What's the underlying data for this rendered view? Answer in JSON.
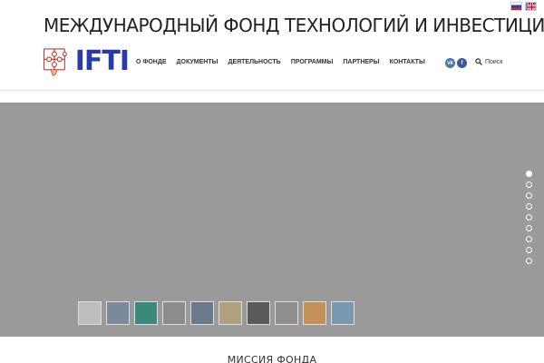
{
  "site": {
    "title": "МЕЖДУНАРОДНЫЙ ФОНД ТЕХНОЛОГИЙ И ИНВЕСТИЦИЙ",
    "logo_text": "IFTI"
  },
  "languages": [
    "ru-flag-icon",
    "gb-flag-icon"
  ],
  "nav": {
    "items": [
      {
        "label": "О ФОНДЕ"
      },
      {
        "label": "ДОКУМЕНТЫ"
      },
      {
        "label": "ДЕЯТЕЛЬНОСТЬ"
      },
      {
        "label": "ПРОГРАММЫ"
      },
      {
        "label": "ПАРТНЕРЫ"
      },
      {
        "label": "КОНТАКТЫ"
      }
    ]
  },
  "social": {
    "vk": "vk",
    "fb": "f"
  },
  "search": {
    "label": "Поиск"
  },
  "slider": {
    "thumb_colors": [
      "#bdbdbd",
      "#7a8a9a",
      "#3a8a7a",
      "#8c8c8c",
      "#6a7a8a",
      "#b0a080",
      "#5a5a5a",
      "#8f8f8f",
      "#c4905a",
      "#7a98b0"
    ],
    "slide_count": 9,
    "active_index": 0
  },
  "mission": {
    "heading": "МИССИЯ ФОНДА"
  }
}
